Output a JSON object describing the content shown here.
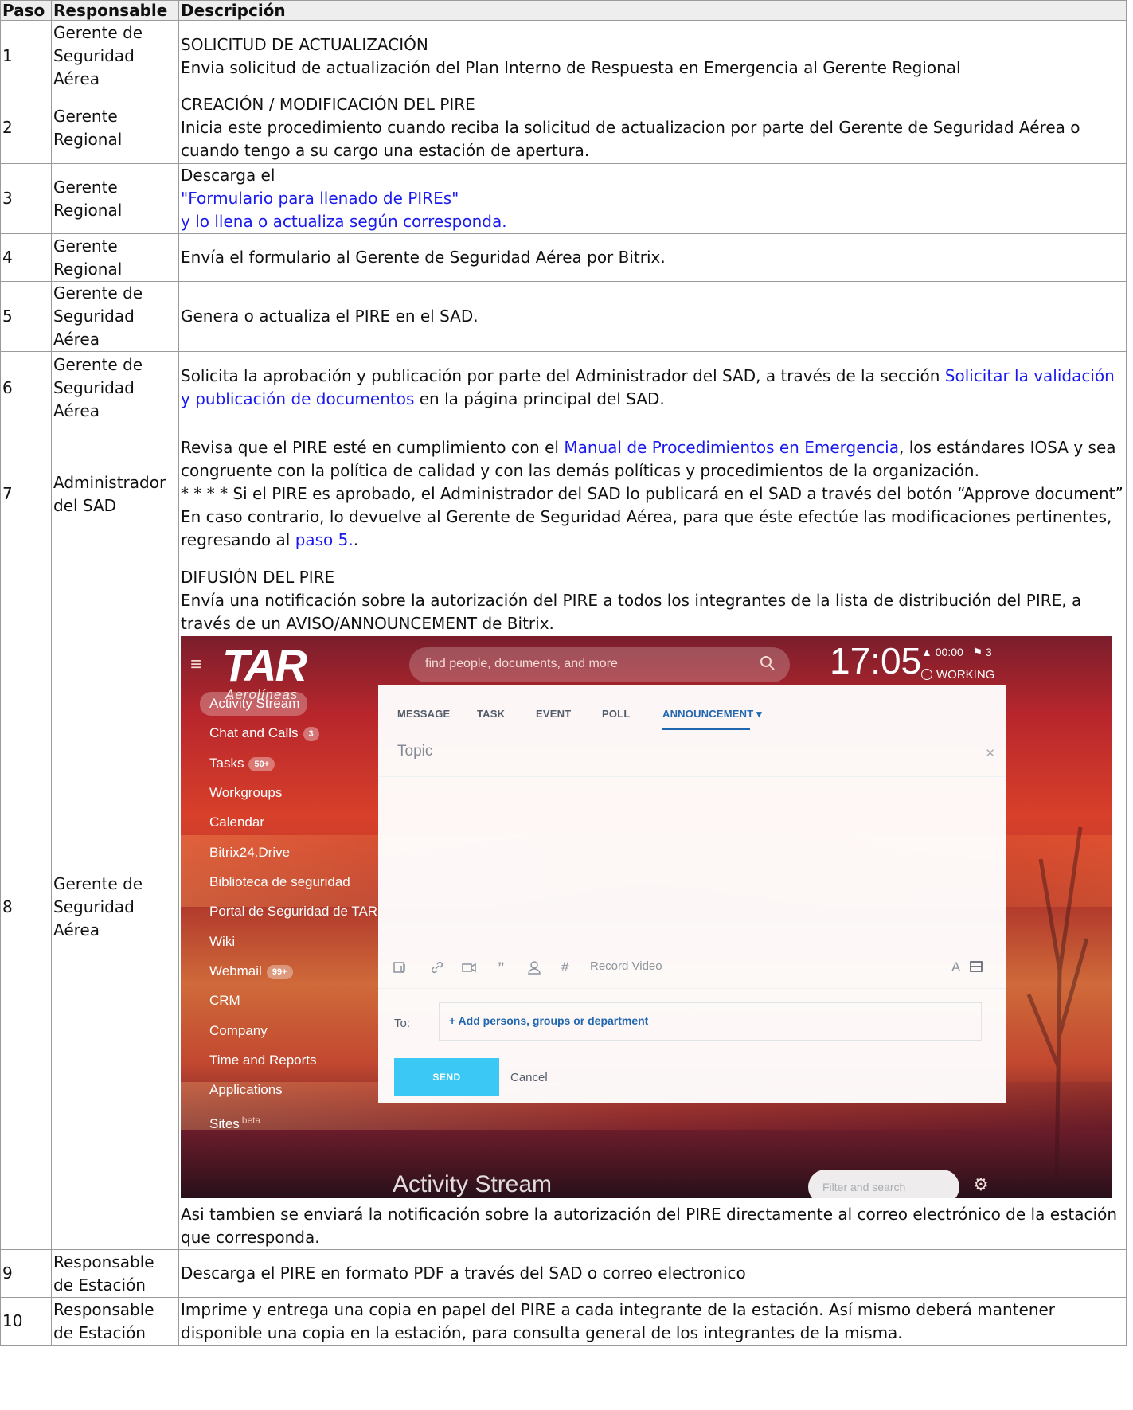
{
  "headers": {
    "step": "Paso",
    "responsible": "Responsable",
    "description": "Descripción"
  },
  "rows": [
    {
      "step": "1",
      "resp": "Gerente de Seguridad Aérea",
      "title": "SOLICITUD DE ACTUALIZACIÓN",
      "text": "Envia solicitud de actualización del Plan Interno de Respuesta en Emergencia al Gerente Regional"
    },
    {
      "step": "2",
      "resp": "Gerente Regional",
      "title": "CREACIÓN / MODIFICACIÓN DEL PIRE",
      "text": "Inicia este procedimiento cuando reciba la solicitud de actualizacion por parte del Gerente de Seguridad Aérea o cuando tengo a su cargo una estación de apertura."
    },
    {
      "step": "3",
      "resp": "Gerente Regional",
      "pre": "Descarga el",
      "link": "\"Formulario para llenado de PIREs\"",
      "post": "y lo llena o actualiza según corresponda."
    },
    {
      "step": "4",
      "resp": "Gerente Regional",
      "text": "Envía el formulario al Gerente de Seguridad Aérea por Bitrix."
    },
    {
      "step": "5",
      "resp": "Gerente de Seguridad Aérea",
      "text": "Genera o actualiza el PIRE en el SAD."
    },
    {
      "step": "6",
      "resp": "Gerente de Seguridad Aérea",
      "pre": "Solicita la aprobación y publicación por parte del Administrador del SAD, a través de la sección ",
      "link": "Solicitar la validación y publicación de documentos",
      "post": " en la página principal del SAD."
    },
    {
      "step": "7",
      "resp": "Administrador del SAD",
      "pre": "Revisa que el PIRE esté en cumplimiento con el ",
      "link": "Manual de Procedimientos en Emergencia",
      "post": ", los estándares IOSA y sea congruente con la política de calidad y con las demás políticas y procedimientos de la organización.",
      "pre2": "* * * * Si el PIRE es aprobado, el Administrador del SAD lo publicará en el SAD a través del botón “Approve document” En caso contrario, lo devuelve al Gerente de Seguridad Aérea, para que éste efectúe las modificaciones pertinentes, regresando al ",
      "link2": "paso 5.",
      "post2": "."
    },
    {
      "step": "8",
      "resp": "Gerente de Seguridad Aérea",
      "title": "DIFUSIÓN DEL PIRE",
      "text": "Envía una notificación sobre la autorización del PIRE a todos los integrantes de la lista de distribución del PIRE, a través de un AVISO/ANNOUNCEMENT de Bitrix.",
      "after": "Asi tambien se enviará la notificación sobre la autorización del PIRE directamente al correo electrónico de la estación que corresponda."
    },
    {
      "step": "9",
      "resp": "Responsable de Estación",
      "text": "Descarga el PIRE en formato PDF a través del SAD o correo electronico"
    },
    {
      "step": "10",
      "resp": "Responsable de Estación",
      "text": "Imprime y entrega una copia en papel del PIRE a cada integrante de la estación. Así mismo deberá mantener disponible una copia en la estación, para consulta general de los integrantes de la misma."
    }
  ],
  "screenshot": {
    "logo": "TAR",
    "logo_sub": "Aerolíneas",
    "search_placeholder": "find people, documents, and more",
    "clock": "17:05",
    "counters": "▲ 00:00   ⚑ 3",
    "status": "WORKING",
    "menu": [
      {
        "label": "Activity Stream",
        "badge": "",
        "active": true
      },
      {
        "label": "Chat and Calls",
        "badge": "3"
      },
      {
        "label": "Tasks",
        "badge": "50+"
      },
      {
        "label": "Workgroups",
        "badge": ""
      },
      {
        "label": "Calendar",
        "badge": ""
      },
      {
        "label": "Bitrix24.Drive",
        "badge": ""
      },
      {
        "label": "Biblioteca de seguridad",
        "badge": ""
      },
      {
        "label": "Portal de Seguridad de TAR",
        "badge": ""
      },
      {
        "label": "Wiki",
        "badge": ""
      },
      {
        "label": "Webmail",
        "badge": "99+"
      },
      {
        "label": "CRM",
        "badge": ""
      },
      {
        "label": "Company",
        "badge": ""
      },
      {
        "label": "Time and Reports",
        "badge": ""
      },
      {
        "label": "Applications",
        "badge": ""
      },
      {
        "label": "Sites",
        "badge": "",
        "sup": "beta"
      }
    ],
    "tabs": [
      "MESSAGE",
      "TASK",
      "EVENT",
      "POLL",
      "ANNOUNCEMENT ▾"
    ],
    "selected_tab": 4,
    "topic_placeholder": "Topic",
    "record_video": "Record Video",
    "to_label": "To:",
    "add_persons": "+ Add persons, groups or department",
    "send": "SEND",
    "cancel": "Cancel",
    "stream_title": "Activity Stream",
    "filter_placeholder": "Filter and search",
    "colors": {
      "link": "#1a1aee",
      "send": "#3bc8f5",
      "tab_selected": "#2067b0"
    }
  }
}
